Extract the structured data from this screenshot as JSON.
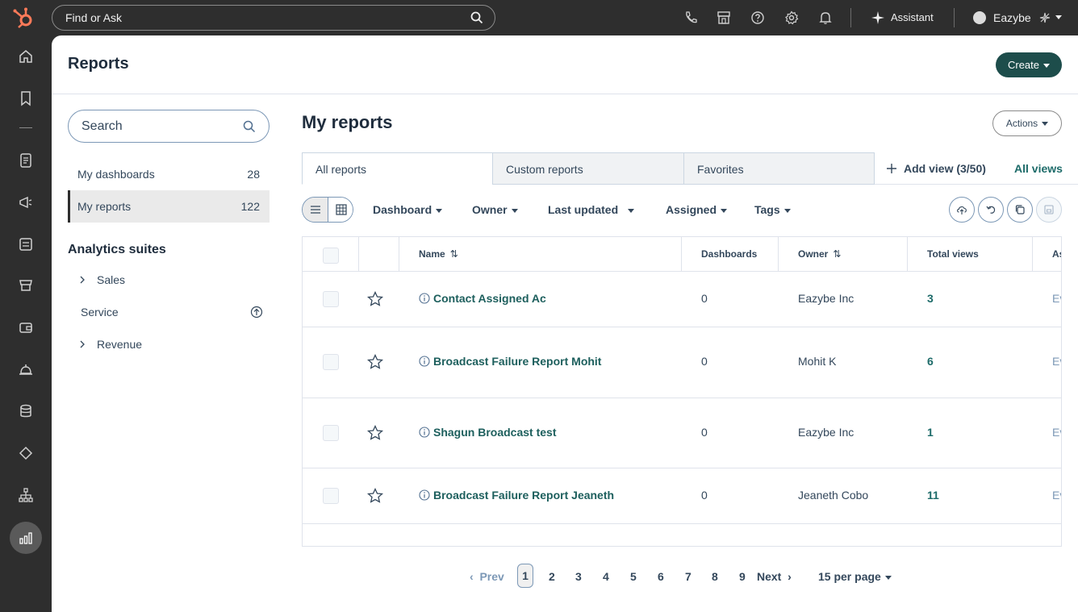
{
  "topbar": {
    "search_placeholder": "Find or Ask",
    "assistant_label": "Assistant",
    "account_name": "Eazybe",
    "icons": [
      "phone-icon",
      "marketplace-icon",
      "help-icon",
      "settings-icon",
      "notifications-icon"
    ]
  },
  "rail": {
    "icons": [
      "home-icon",
      "bookmark-icon",
      "contacts-icon",
      "marketing-icon",
      "content-icon",
      "commerce-icon",
      "payments-icon",
      "service-icon",
      "data-icon",
      "automation-icon",
      "org-icon",
      "reporting-icon"
    ]
  },
  "header": {
    "title": "Reports",
    "create_label": "Create"
  },
  "sidebar": {
    "search_placeholder": "Search",
    "items": [
      {
        "label": "My dashboards",
        "count": "28"
      },
      {
        "label": "My reports",
        "count": "122"
      }
    ],
    "suites_title": "Analytics suites",
    "suites": [
      {
        "label": "Sales"
      },
      {
        "label": "Service"
      },
      {
        "label": "Revenue"
      }
    ]
  },
  "main": {
    "title": "My reports",
    "actions_label": "Actions",
    "tabs": [
      {
        "label": "All reports"
      },
      {
        "label": "Custom reports"
      },
      {
        "label": "Favorites"
      }
    ],
    "add_view_label": "Add view (3/50)",
    "all_views_label": "All views",
    "filters": [
      {
        "label": "Dashboard"
      },
      {
        "label": "Owner"
      },
      {
        "label": "Last updated"
      },
      {
        "label": "Assigned"
      },
      {
        "label": "Tags"
      }
    ]
  },
  "table": {
    "columns": [
      "Name",
      "Dashboards",
      "Owner",
      "Total views",
      "As"
    ],
    "rows": [
      {
        "name": "Contact Assigned Ac",
        "dashboards": "0",
        "owner": "Eazybe Inc",
        "views": "3",
        "assigned": "Ev"
      },
      {
        "name": "Broadcast Failure Report Mohit",
        "dashboards": "0",
        "owner": "Mohit K",
        "views": "6",
        "assigned": "Ev"
      },
      {
        "name": "Shagun Broadcast test",
        "dashboards": "0",
        "owner": "Eazybe Inc",
        "views": "1",
        "assigned": "Ev"
      },
      {
        "name": "Broadcast Failure Report Jeaneth",
        "dashboards": "0",
        "owner": "Jeaneth Cobo",
        "views": "11",
        "assigned": "Ev"
      }
    ]
  },
  "pagination": {
    "prev_label": "Prev",
    "pages": [
      "1",
      "2",
      "3",
      "4",
      "5",
      "6",
      "7",
      "8",
      "9"
    ],
    "current_page": "1",
    "next_label": "Next",
    "per_page_label": "15 per page"
  },
  "colors": {
    "brand": "#ff7a59",
    "primary_button": "#1d4d4b",
    "link": "#1d5f5d"
  }
}
